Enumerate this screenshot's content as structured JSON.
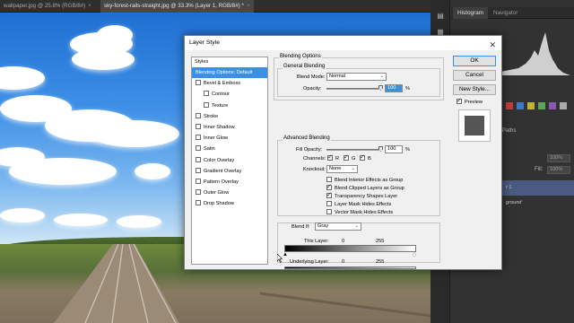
{
  "tabs": [
    {
      "label": "wallpaper.jpg @ 25.8% (RGB/8#)",
      "active": false
    },
    {
      "label": "sky-forest-rails-straight.jpg @ 33.3% (Layer 1, RGB/8#) *",
      "active": true
    }
  ],
  "tab_close_glyph": "×",
  "panel": {
    "tabs": [
      "Histogram",
      "Navigator"
    ],
    "paths_label": "Paths",
    "fill_label": "Fill:",
    "fill_value": "100%",
    "opacity_value": "100%",
    "layer_rows": [
      "r 1",
      "ground"
    ]
  },
  "dialog": {
    "title": "Layer Style",
    "close_glyph": "✕",
    "styles_header": "Styles",
    "style_items": [
      {
        "label": "Blending Options: Default",
        "selected": true,
        "checkbox": false,
        "indent": false
      },
      {
        "label": "Bevel & Emboss",
        "checkbox": true,
        "indent": false
      },
      {
        "label": "Contour",
        "checkbox": true,
        "indent": true
      },
      {
        "label": "Texture",
        "checkbox": true,
        "indent": true
      },
      {
        "label": "Stroke",
        "checkbox": true,
        "indent": false
      },
      {
        "label": "Inner Shadow",
        "checkbox": true,
        "indent": false
      },
      {
        "label": "Inner Glow",
        "checkbox": true,
        "indent": false
      },
      {
        "label": "Satin",
        "checkbox": true,
        "indent": false
      },
      {
        "label": "Color Overlay",
        "checkbox": true,
        "indent": false
      },
      {
        "label": "Gradient Overlay",
        "checkbox": true,
        "indent": false
      },
      {
        "label": "Pattern Overlay",
        "checkbox": true,
        "indent": false
      },
      {
        "label": "Outer Glow",
        "checkbox": true,
        "indent": false
      },
      {
        "label": "Drop Shadow",
        "checkbox": true,
        "indent": false
      }
    ],
    "blending_options": {
      "title": "Blending Options",
      "general_title": "General Blending",
      "blend_mode_label": "Blend Mode:",
      "blend_mode_value": "Normal",
      "opacity_label": "Opacity:",
      "opacity_value": "100",
      "opacity_unit": "%",
      "opacity_fraction": 1.0
    },
    "advanced": {
      "title": "Advanced Blending",
      "fill_label": "Fill Opacity:",
      "fill_value": "100",
      "fill_unit": "%",
      "fill_fraction": 1.0,
      "channels_label": "Channels:",
      "channels": [
        {
          "label": "R",
          "checked": true
        },
        {
          "label": "G",
          "checked": true
        },
        {
          "label": "B",
          "checked": true
        }
      ],
      "knockout_label": "Knockout:",
      "knockout_value": "None",
      "options": [
        {
          "label": "Blend Interior Effects as Group",
          "checked": false
        },
        {
          "label": "Blend Clipped Layers as Group",
          "checked": true
        },
        {
          "label": "Transparency Shapes Layer",
          "checked": true
        },
        {
          "label": "Layer Mask Hides Effects",
          "checked": false
        },
        {
          "label": "Vector Mask Hides Effects",
          "checked": false
        }
      ]
    },
    "blend_if": {
      "label": "Blend If:",
      "value": "Gray",
      "this_layer_label": "This Layer:",
      "this_layer_low": "0",
      "this_layer_high": "255",
      "underlying_label": "Underlying Layer:",
      "underlying_low": "0",
      "underlying_high": "255"
    },
    "buttons": {
      "ok": "OK",
      "cancel": "Cancel",
      "new_style": "New Style...",
      "preview_label": "Preview",
      "preview_checked": true
    }
  }
}
